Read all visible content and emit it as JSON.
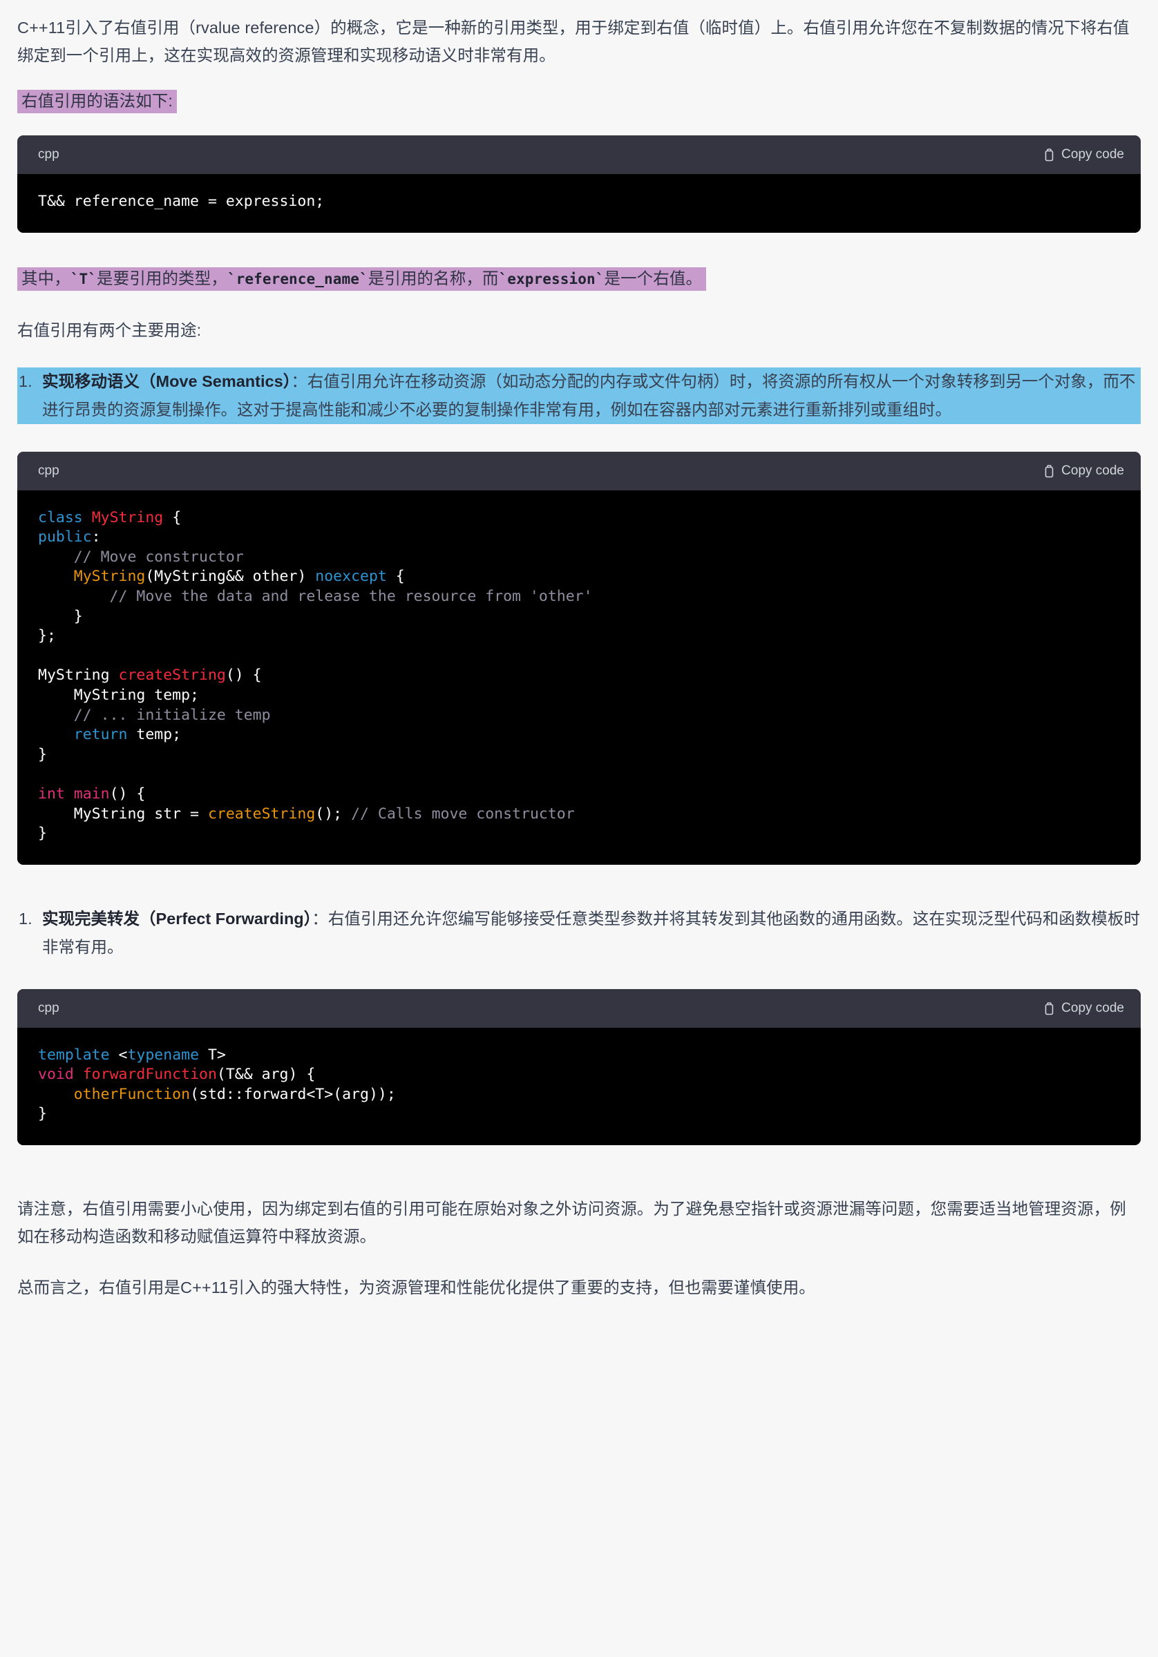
{
  "intro_paragraph": "C++11引入了右值引用（rvalue reference）的概念，它是一种新的引用类型，用于绑定到右值（临时值）上。右值引用允许您在不复制数据的情况下将右值绑定到一个引用上，这在实现高效的资源管理和实现移动语义时非常有用。",
  "highlight_syntax_label": "右值引用的语法如下:",
  "code_block_1": {
    "language": "cpp",
    "copy_label": "Copy code",
    "lines": [
      "T&& reference_name = expression;"
    ]
  },
  "highlight_explanation": {
    "part1": "其中，",
    "code1": "`T`",
    "part2": "是要引用的类型，",
    "code2": "`reference_name`",
    "part3": "是引用的名称，而",
    "code3": "`expression`",
    "part4": "是一个右值。"
  },
  "uses_intro": "右值引用有两个主要用途:",
  "list_items": [
    {
      "number": "1.",
      "bold": "实现移动语义（Move Semantics）",
      "text": "：右值引用允许在移动资源（如动态分配的内存或文件句柄）时，将资源的所有权从一个对象转移到另一个对象，而不进行昂贵的资源复制操作。这对于提高性能和减少不必要的复制操作非常有用，例如在容器内部对元素进行重新排列或重组时。",
      "highlighted": true
    },
    {
      "number": "1.",
      "bold": "实现完美转发（Perfect Forwarding）",
      "text": "：右值引用还允许您编写能够接受任意类型参数并将其转发到其他函数的通用函数。这在实现泛型代码和函数模板时非常有用。",
      "highlighted": false
    }
  ],
  "code_block_2": {
    "language": "cpp",
    "copy_label": "Copy code",
    "lines": [
      "class MyString {",
      "public:",
      "    // Move constructor",
      "    MyString(MyString&& other) noexcept {",
      "        // Move the data and release the resource from 'other'",
      "    }",
      "};",
      "",
      "MyString createString() {",
      "    MyString temp;",
      "    // ... initialize temp",
      "    return temp;",
      "}",
      "",
      "int main() {",
      "    MyString str = createString(); // Calls move constructor",
      "}"
    ]
  },
  "code_block_3": {
    "language": "cpp",
    "copy_label": "Copy code",
    "lines": [
      "template <typename T>",
      "void forwardFunction(T&& arg) {",
      "    otherFunction(std::forward<T>(arg));",
      "}"
    ]
  },
  "closing_paragraph_1": "请注意，右值引用需要小心使用，因为绑定到右值的引用可能在原始对象之外访问资源。为了避免悬空指针或资源泄漏等问题，您需要适当地管理资源，例如在移动构造函数和移动赋值运算符中释放资源。",
  "closing_paragraph_2": "总而言之，右值引用是C++11引入的强大特性，为资源管理和性能优化提供了重要的支持，但也需要谨慎使用。",
  "colors": {
    "page_background": "#F7F7F8",
    "text": "#374151",
    "highlight_purple": "#C89BCD",
    "highlight_blue": "#74C3EA",
    "code_header_bg": "#343541",
    "code_body_bg": "#000000",
    "token_keyword": "#2E95D3",
    "token_type": "#F22C3D",
    "token_function": "#E9950C",
    "token_comment": "#8E8EA0",
    "token_pink": "#DF3079"
  }
}
